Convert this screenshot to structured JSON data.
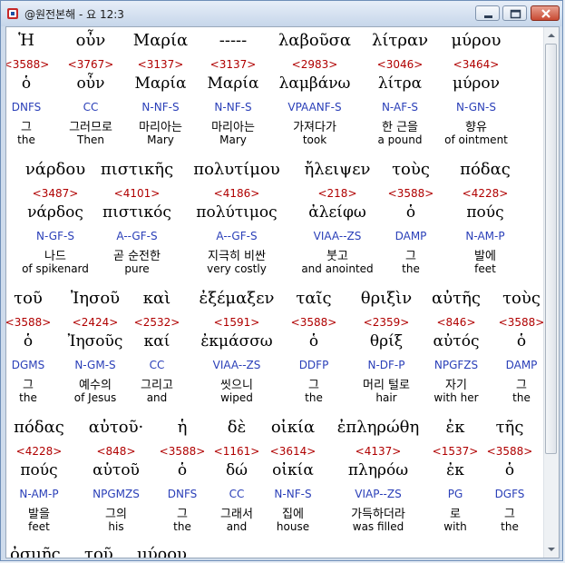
{
  "window": {
    "title": "@원전본해 - 요 12:3"
  },
  "rows": [
    [
      {
        "g": "Ἡ",
        "num": "<3588>",
        "lex": "ὁ",
        "pars": "DNFS",
        "kor": "그",
        "eng": "the"
      },
      {
        "g": "οὖν",
        "num": "<3767>",
        "lex": "οὖν",
        "pars": "CC",
        "kor": "그러므로",
        "eng": "Then"
      },
      {
        "g": "Μαρία",
        "num": "<3137>",
        "lex": "Μαρία",
        "pars": "N-NF-S",
        "kor": "마리아는",
        "eng": "Mary"
      },
      {
        "g": "-----",
        "num": "<3137>",
        "lex": "Μαρία",
        "pars": "N-NF-S",
        "kor": "마리아는",
        "eng": "Mary"
      },
      {
        "g": "λαβοῦσα",
        "num": "<2983>",
        "lex": "λαμβάνω",
        "pars": "VPAANF-S",
        "kor": "가져다가",
        "eng": "took"
      },
      {
        "g": "λίτραν",
        "num": "<3046>",
        "lex": "λίτρα",
        "pars": "N-AF-S",
        "kor": "한 근을",
        "eng": "a pound"
      },
      {
        "g": "μύρου",
        "num": "<3464>",
        "lex": "μύρον",
        "pars": "N-GN-S",
        "kor": "향유",
        "eng": "of ointment"
      }
    ],
    [
      {
        "g": "νάρδου",
        "num": "<3487>",
        "lex": "νάρδος",
        "pars": "N-GF-S",
        "kor": "나드",
        "eng": "of spikenard"
      },
      {
        "g": "πιστικῆς",
        "num": "<4101>",
        "lex": "πιστικός",
        "pars": "A--GF-S",
        "kor": "곧 순전한",
        "eng": "pure"
      },
      {
        "g": "πολυτίμου",
        "num": "<4186>",
        "lex": "πολύτιμος",
        "pars": "A--GF-S",
        "kor": "지극히 비싼",
        "eng": "very costly"
      },
      {
        "g": "ἤλειψεν",
        "num": "<218>",
        "lex": "ἀλείφω",
        "pars": "VIAA--ZS",
        "kor": "붓고",
        "eng": "and anointed"
      },
      {
        "g": "τοὺς",
        "num": "<3588>",
        "lex": "ὁ",
        "pars": "DAMP",
        "kor": "그",
        "eng": "the"
      },
      {
        "g": "πόδας",
        "num": "<4228>",
        "lex": "πούς",
        "pars": "N-AM-P",
        "kor": "발에",
        "eng": "feet"
      }
    ],
    [
      {
        "g": "τοῦ",
        "num": "<3588>",
        "lex": "ὁ",
        "pars": "DGMS",
        "kor": "그",
        "eng": "the"
      },
      {
        "g": "Ἰησοῦ",
        "num": "<2424>",
        "lex": "Ἰησοῦς",
        "pars": "N-GM-S",
        "kor": "예수의",
        "eng": "of Jesus"
      },
      {
        "g": "καὶ",
        "num": "<2532>",
        "lex": "καί",
        "pars": "CC",
        "kor": "그리고",
        "eng": "and"
      },
      {
        "g": "ἐξέμαξεν",
        "num": "<1591>",
        "lex": "ἐκμάσσω",
        "pars": "VIAA--ZS",
        "kor": "씻으니",
        "eng": "wiped"
      },
      {
        "g": "ταῖς",
        "num": "<3588>",
        "lex": "ὁ",
        "pars": "DDFP",
        "kor": "그",
        "eng": "the"
      },
      {
        "g": "θριξὶν",
        "num": "<2359>",
        "lex": "θρίξ",
        "pars": "N-DF-P",
        "kor": "머리 털로",
        "eng": "hair"
      },
      {
        "g": "αὐτῆς",
        "num": "<846>",
        "lex": "αὐτός",
        "pars": "NPGFZS",
        "kor": "자기",
        "eng": "with her"
      },
      {
        "g": "τοὺς",
        "num": "<3588>",
        "lex": "ὁ",
        "pars": "DAMP",
        "kor": "그",
        "eng": "the"
      }
    ],
    [
      {
        "g": "πόδας",
        "num": "<4228>",
        "lex": "πούς",
        "pars": "N-AM-P",
        "kor": "발을",
        "eng": "feet"
      },
      {
        "g": "αὐτοῦ·",
        "num": "<848>",
        "lex": "αὑτοῦ",
        "pars": "NPGMZS",
        "kor": "그의",
        "eng": "his"
      },
      {
        "g": "ἡ",
        "num": "<3588>",
        "lex": "ὁ",
        "pars": "DNFS",
        "kor": "그",
        "eng": "the"
      },
      {
        "g": "δὲ",
        "num": "<1161>",
        "lex": "δώ",
        "pars": "CC",
        "kor": "그래서",
        "eng": "and"
      },
      {
        "g": "οἰκία",
        "num": "<3614>",
        "lex": "οἰκία",
        "pars": "N-NF-S",
        "kor": "집에",
        "eng": "house"
      },
      {
        "g": "ἐπληρώθη",
        "num": "<4137>",
        "lex": "πληρόω",
        "pars": "VIAP--ZS",
        "kor": "가득하더라",
        "eng": "was filled"
      },
      {
        "g": "ἐκ",
        "num": "<1537>",
        "lex": "ἐκ",
        "pars": "PG",
        "kor": "로",
        "eng": "with"
      },
      {
        "g": "τῆς",
        "num": "<3588>",
        "lex": "ὁ",
        "pars": "DGFS",
        "kor": "그",
        "eng": "the"
      }
    ]
  ],
  "partial_row": [
    "ὀσμῆς",
    "τοῦ",
    "μύρου"
  ]
}
